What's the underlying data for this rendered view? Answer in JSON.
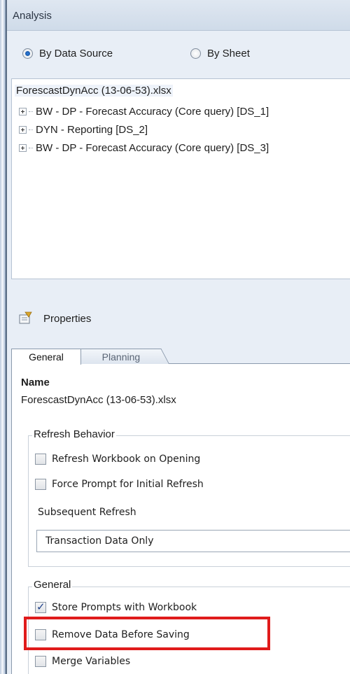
{
  "header": {
    "title": "Analysis"
  },
  "view_mode": {
    "options": [
      "By Data Source",
      "By Sheet"
    ],
    "selected": "By Data Source"
  },
  "tree": {
    "root": "ForescastDynAcc (13-06-53).xlsx",
    "items": [
      "BW - DP - Forecast Accuracy (Core query) [DS_1]",
      "DYN - Reporting [DS_2]",
      "BW - DP - Forecast Accuracy (Core query) [DS_3]"
    ]
  },
  "properties": {
    "label": "Properties",
    "tabs": [
      "General",
      "Planning"
    ],
    "active_tab": "General"
  },
  "general": {
    "name_label": "Name",
    "name_value": "ForescastDynAcc (13-06-53).xlsx",
    "refresh_behavior": {
      "legend": "Refresh Behavior",
      "checkboxes": [
        {
          "label": "Refresh Workbook on Opening",
          "checked": false
        },
        {
          "label": "Force Prompt for Initial Refresh",
          "checked": false
        }
      ],
      "subsequent_label": "Subsequent Refresh",
      "subsequent_value": "Transaction Data Only"
    },
    "general_group": {
      "legend": "General",
      "checkboxes": [
        {
          "label": "Store Prompts with Workbook",
          "checked": true
        },
        {
          "label": "Remove Data Before Saving",
          "checked": false
        },
        {
          "label": "Merge Variables",
          "checked": false
        }
      ]
    }
  },
  "colors": {
    "highlight": "#e01b1b",
    "panel_bg": "#e8eef6",
    "frame": "#5d6f86"
  }
}
